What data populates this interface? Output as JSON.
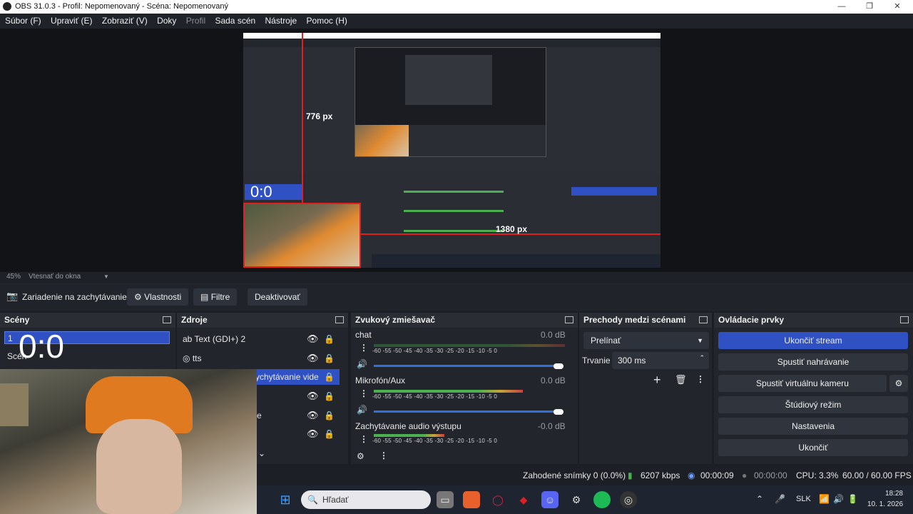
{
  "window": {
    "title": "OBS 31.0.3 - Profil: Nepomenovaný - Scéna: Nepomenovaný",
    "minimize": "—",
    "maximize": "❐",
    "close": "✕"
  },
  "menu": [
    "Súbor (F)",
    "Upraviť (E)",
    "Zobraziť (V)",
    "Doky",
    "Profil",
    "Sada scén",
    "Nástroje",
    "Pomoc (H)"
  ],
  "preview": {
    "measure_height": "776 px",
    "measure_width": "1380 px",
    "inner_timer": "0:0",
    "zoom": "45%",
    "fit_label": "Vtesnať do okna"
  },
  "toolbar": {
    "device_label": "Zariadenie na zachytávanie",
    "properties": "Vlastnosti",
    "filters": "Filtre",
    "deactivate": "Deaktivovať"
  },
  "scenes": {
    "title": "Scény",
    "items": [
      "1",
      "Scén"
    ],
    "timer": "0:0"
  },
  "sources": {
    "title": "Zdroje",
    "items": [
      "Text (GDI+) 2",
      "tts",
      "ychytávanie vide",
      "",
      "e",
      ""
    ]
  },
  "mixer": {
    "title": "Zvukový zmiešavač",
    "ticks": "-60  -55  -50  -45  -40  -35  -30  -25  -20  -15  -10   -5   0",
    "channels": [
      {
        "name": "chat",
        "db": "0.0 dB",
        "level": 0.0
      },
      {
        "name": "Mikrofón/Aux",
        "db": "0.0 dB",
        "level": 0.78
      },
      {
        "name": "Zachytávanie audio výstupu",
        "db": "-0.0 dB",
        "level": 0.37
      }
    ]
  },
  "transitions": {
    "title": "Prechody medzi scénami",
    "selected": "Prelínať",
    "duration_label": "Trvanie",
    "duration_value": "300 ms"
  },
  "controls": {
    "title": "Ovládacie prvky",
    "buttons": [
      "Ukončiť stream",
      "Spustiť nahrávanie",
      "Spustiť virtuálnu kameru",
      "Štúdiový režim",
      "Nastavenia",
      "Ukončiť"
    ]
  },
  "status": {
    "dropped": "Zahodené snímky 0 (0.0%)",
    "bitrate": "6207 kbps",
    "stream_time": "00:00:09",
    "rec_time": "00:00:00",
    "cpu": "CPU: 3.3%",
    "fps": "60.00 / 60.00 FPS"
  },
  "taskbar": {
    "search_placeholder": "Hľadať",
    "lang": "SLK",
    "time": "18:28",
    "date": "10. 1. 2026"
  },
  "colors": {
    "accent": "#2f51c4",
    "meter_green": "#4caf50",
    "meter_red": "#c84040",
    "selection_red": "#e02020"
  }
}
